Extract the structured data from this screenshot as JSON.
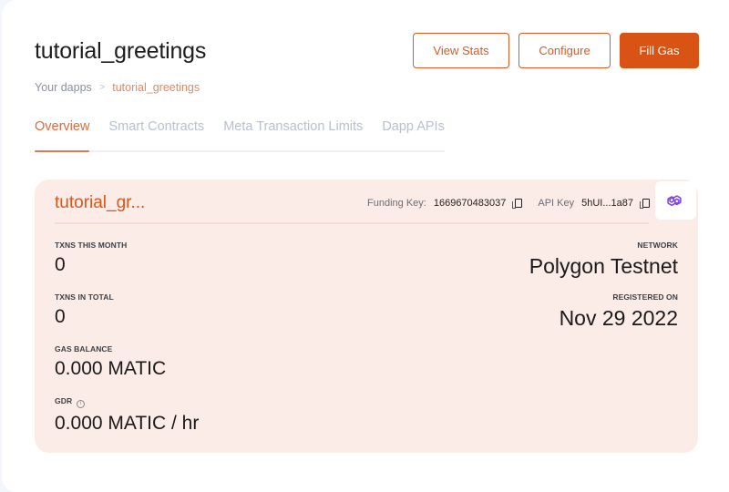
{
  "header": {
    "title": "tutorial_greetings",
    "buttons": {
      "view_stats": "View Stats",
      "configure": "Configure",
      "fill_gas": "Fill Gas"
    }
  },
  "breadcrumb": {
    "root": "Your dapps",
    "separator": ">",
    "current": "tutorial_greetings"
  },
  "tabs": [
    {
      "label": "Overview",
      "active": true
    },
    {
      "label": "Smart Contracts",
      "active": false
    },
    {
      "label": "Meta Transaction Limits",
      "active": false
    },
    {
      "label": "Dapp APIs",
      "active": false
    }
  ],
  "card": {
    "title": "tutorial_gr...",
    "funding_key_label": "Funding Key:",
    "funding_key_value": "1669670483037",
    "api_key_label": "API Key",
    "api_key_value": "5hUI...1a87",
    "network_icon": "polygon-icon",
    "stats_left": [
      {
        "label": "TXNS THIS MONTH",
        "value": "0"
      },
      {
        "label": "TXNS IN TOTAL",
        "value": "0"
      },
      {
        "label": "GAS BALANCE",
        "value": "0.000 MATIC"
      },
      {
        "label": "GDR",
        "value": "0.000 MATIC / hr",
        "info_icon": "info-icon"
      }
    ],
    "stats_right": [
      {
        "label": "NETWORK",
        "value": "Polygon Testnet"
      },
      {
        "label": "REGISTERED ON",
        "value": "Nov 29 2022"
      }
    ]
  },
  "colors": {
    "accent": "#d95315",
    "card_bg": "#fbece7",
    "polygon_purple": "#8247e5"
  }
}
